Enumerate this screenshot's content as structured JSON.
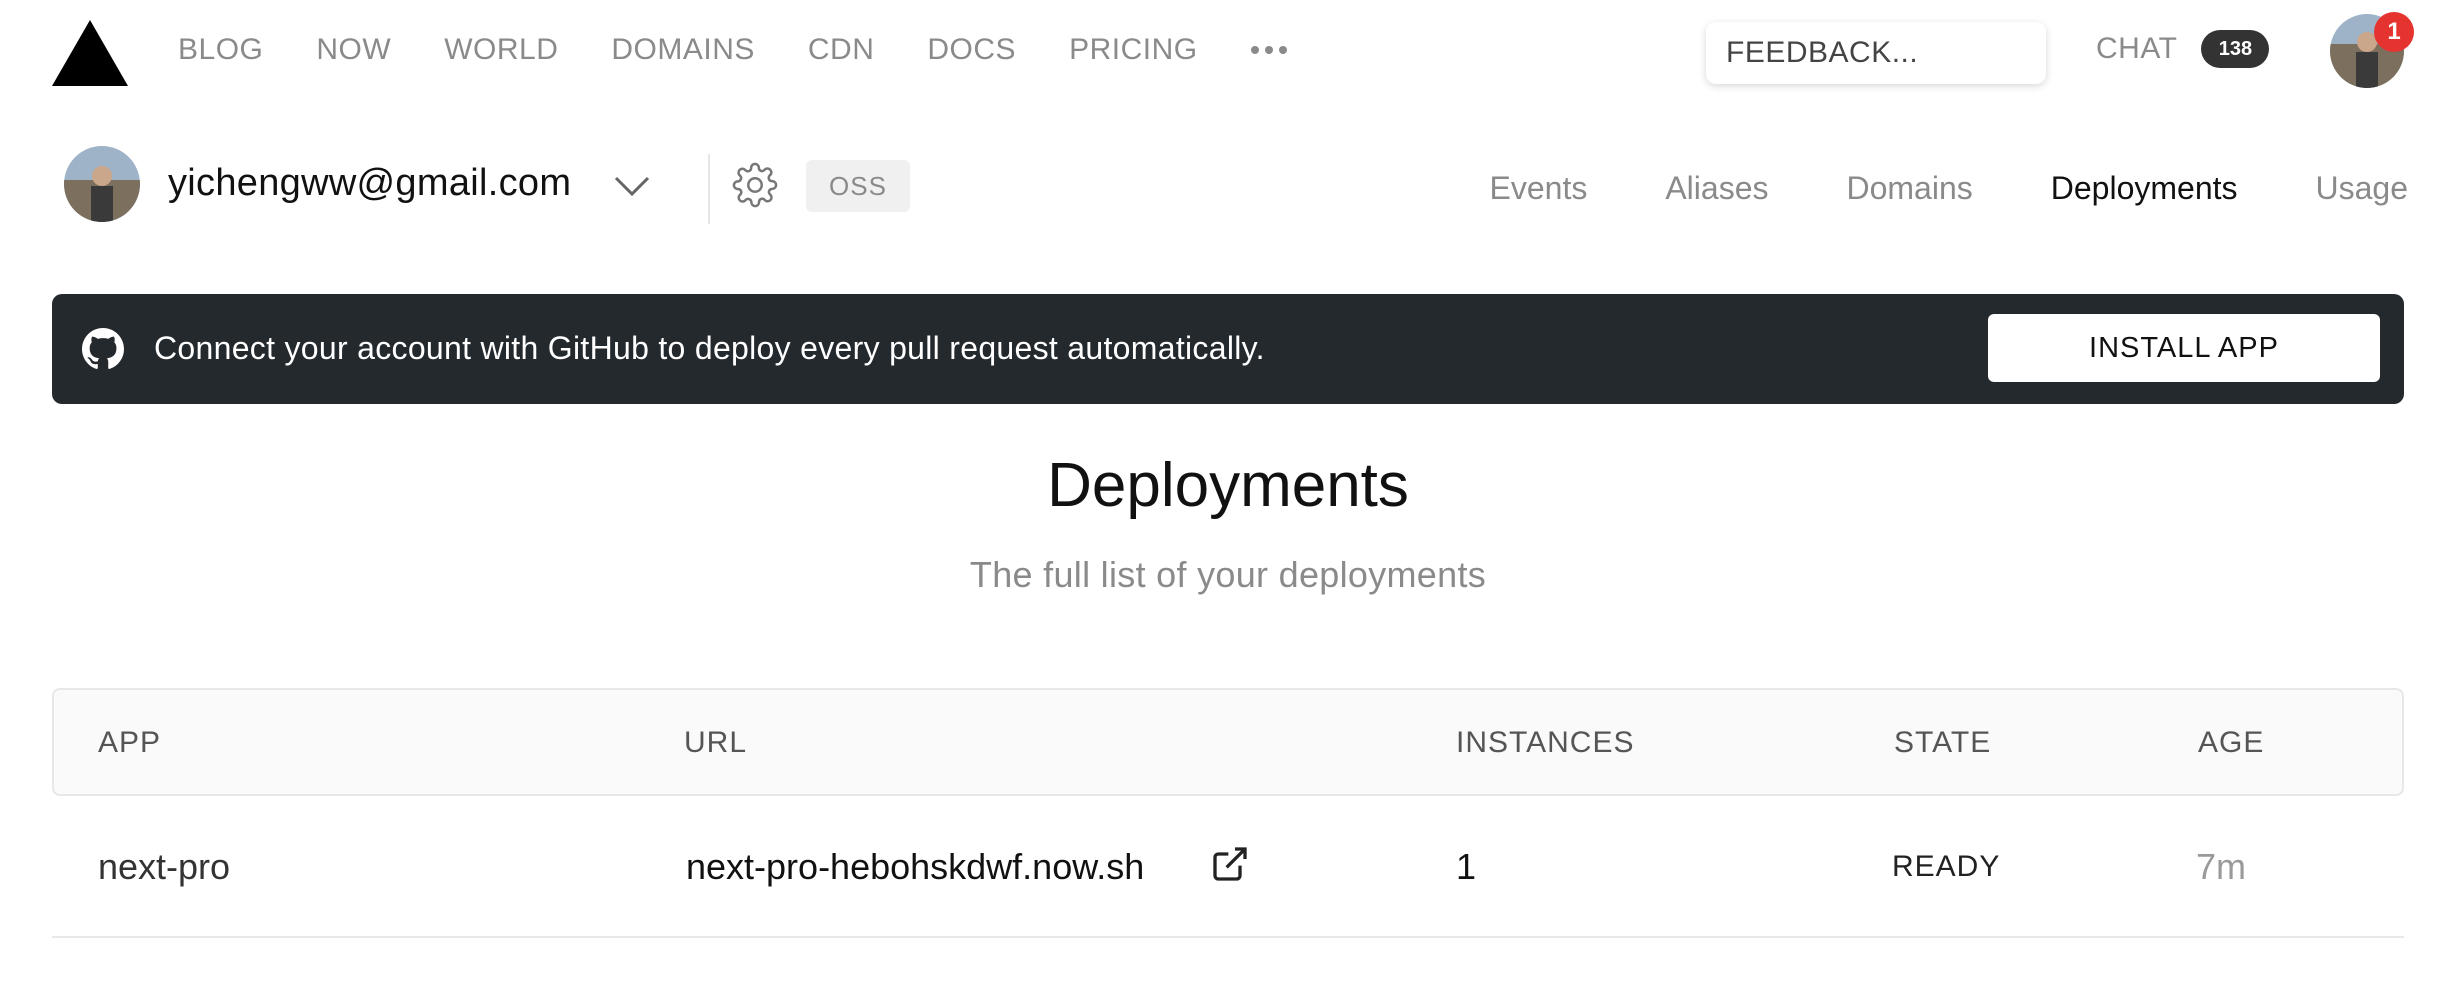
{
  "nav": {
    "links": [
      "BLOG",
      "NOW",
      "WORLD",
      "DOMAINS",
      "CDN",
      "DOCS",
      "PRICING"
    ],
    "feedback_placeholder": "FEEDBACK...",
    "chat_label": "CHAT",
    "chat_count": "138",
    "notification_count": "1"
  },
  "account": {
    "email": "yichengww@gmail.com",
    "plan_badge": "OSS"
  },
  "subnav": {
    "items": [
      "Events",
      "Aliases",
      "Domains",
      "Deployments",
      "Usage"
    ],
    "active": "Deployments"
  },
  "banner": {
    "text": "Connect your account with GitHub to deploy every pull request automatically.",
    "button_label": "INSTALL APP",
    "background": "#24292e"
  },
  "main": {
    "title": "Deployments",
    "subtitle": "The full list of your deployments"
  },
  "table": {
    "headers": {
      "app": "APP",
      "url": "URL",
      "instances": "INSTANCES",
      "state": "STATE",
      "age": "AGE"
    },
    "rows": [
      {
        "app": "next-pro",
        "url": "next-pro-hebohskdwf.now.sh",
        "instances": "1",
        "state": "READY",
        "age": "7m"
      }
    ]
  },
  "icons": [
    "triangle-logo",
    "more-icon",
    "avatar",
    "chevron-down-icon",
    "gear-icon",
    "github-icon",
    "external-link-icon"
  ]
}
